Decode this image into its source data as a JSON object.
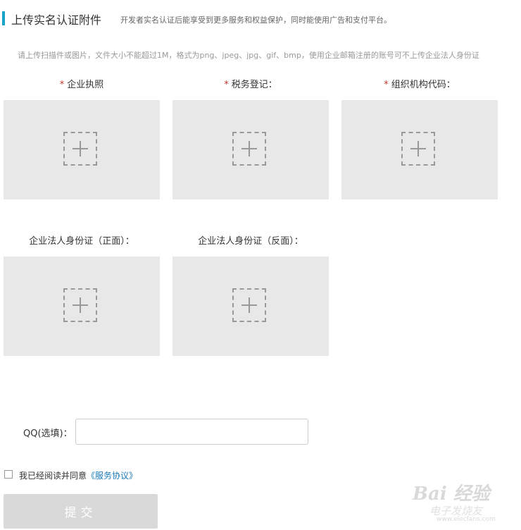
{
  "header": {
    "title": "上传实名认证附件",
    "description": "开发者实名认证后能享受到更多服务和权益保护，同时能使用广告和支付平台。"
  },
  "hint": "请上传扫描件或图片，文件大小不能超过1M，格式为png、jpeg、jpg、gif、bmp，使用企业邮箱注册的账号可不上传企业法人身份证",
  "uploads": [
    {
      "label": "企业执照",
      "required": true,
      "required_mark": "*"
    },
    {
      "label": "税务登记：",
      "required": true,
      "required_mark": "*"
    },
    {
      "label": "组织机构代码：",
      "required": true,
      "required_mark": "*"
    },
    {
      "label": "企业法人身份证（正面）：",
      "required": false
    },
    {
      "label": "企业法人身份证（反面）：",
      "required": false
    }
  ],
  "qq": {
    "label": "QQ(选填)：",
    "value": "",
    "placeholder": ""
  },
  "agreement": {
    "text": "我已经阅读并同意",
    "link": "《服务协议》",
    "checked": false
  },
  "submit": {
    "label": "提交"
  },
  "watermark": {
    "main": "Bai 经验",
    "sub": "电子发烧友",
    "url": "www.elecfans.com"
  },
  "colors": {
    "accent": "#1aa3c9",
    "required": "#c0392b",
    "link": "#1a7bb9",
    "upload_bg": "#e8e8e8",
    "button_disabled": "#d9d9d9"
  }
}
